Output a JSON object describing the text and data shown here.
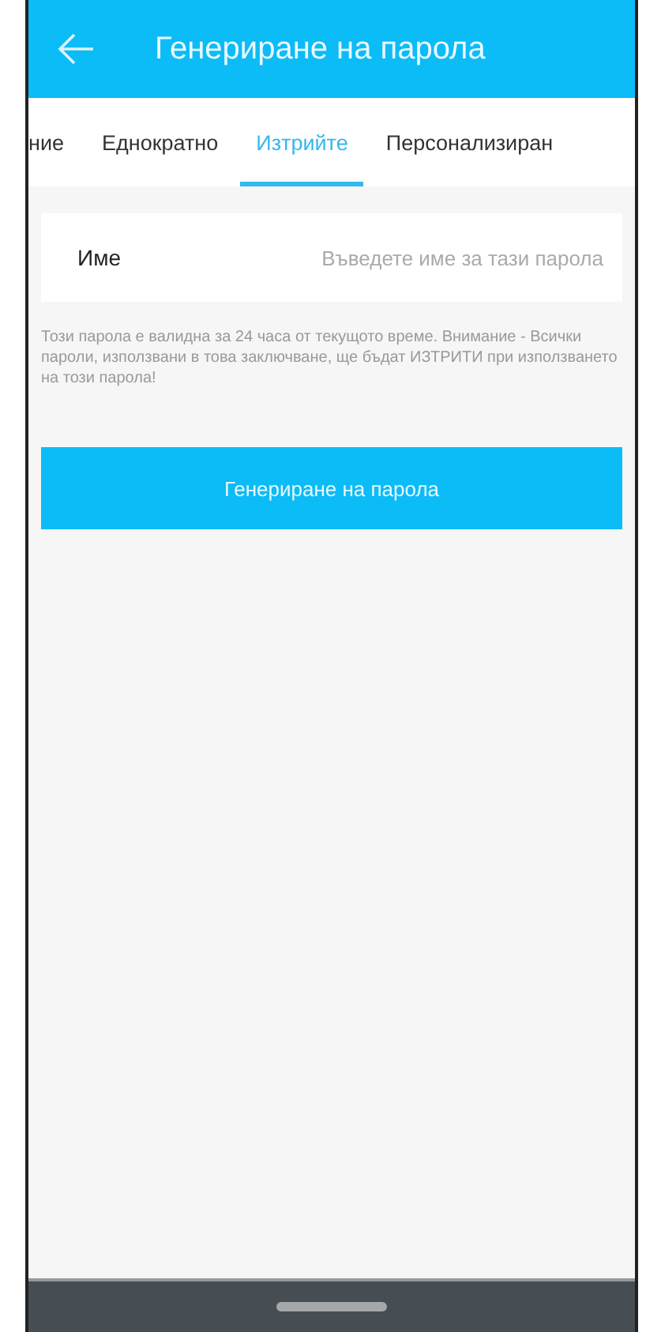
{
  "app_bar": {
    "title": "Генериране на парола"
  },
  "tabs": [
    {
      "label": "ние",
      "selected": false
    },
    {
      "label": "Еднократно",
      "selected": false
    },
    {
      "label": "Изтрийте",
      "selected": true
    },
    {
      "label": "Персонализиран",
      "selected": false
    }
  ],
  "form": {
    "name_label": "Име",
    "name_placeholder": "Въведете име за тази парола"
  },
  "note": "Този парола е валидна за 24 часа от текущото време. Внимание - Всички пароли, използвани в това заключване, ще бъдат ИЗТРИТИ при използването на този парола!",
  "generate_button": "Генериране на парола"
}
